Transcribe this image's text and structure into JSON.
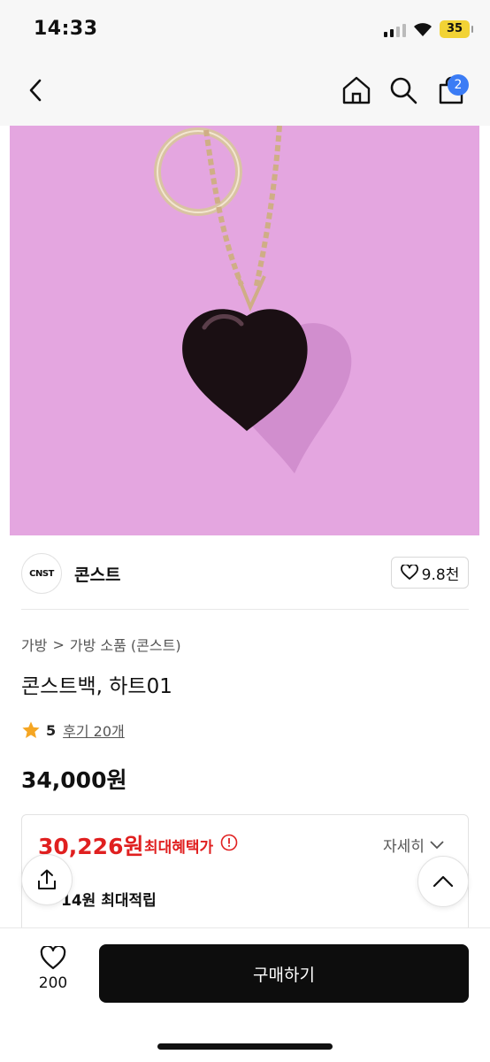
{
  "status_bar": {
    "time": "14:33",
    "battery": "35"
  },
  "header": {
    "cart_count": "2"
  },
  "brand": {
    "logo_text": "CNST",
    "name": "콘스트",
    "likes": "9.8천"
  },
  "breadcrumb": {
    "level1": "가방",
    "separator": ">",
    "level2": "가방 소품 (콘스트)"
  },
  "product": {
    "title": "콘스트백, 하트01",
    "rating": "5",
    "review_link": "후기 20개",
    "price": "34,000원"
  },
  "benefit": {
    "price": "30,226원",
    "label": "최대혜택가",
    "detail_label": "자세히",
    "points": "14원 최대적립"
  },
  "bottom_bar": {
    "wish_count": "200",
    "buy_label": "구매하기"
  },
  "colors": {
    "accent_red": "#e02020",
    "badge_blue": "#3b7cf5",
    "image_bg": "#e4a6e0",
    "buy_button": "#0d0d0d"
  }
}
